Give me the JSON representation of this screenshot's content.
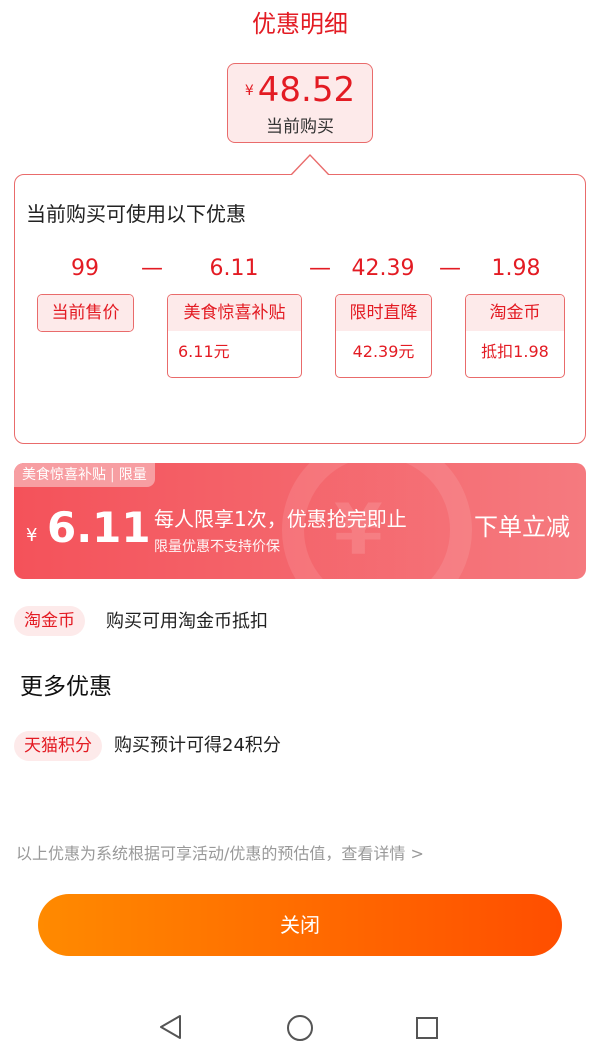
{
  "header": {
    "title": "优惠明细"
  },
  "current_price": {
    "currency": "¥",
    "amount": "48.52",
    "label": "当前购买"
  },
  "breakdown": {
    "title": "当前购买可使用以下优惠",
    "formula": {
      "base": "99",
      "minus": "—",
      "item1": "6.11",
      "item2": "42.39",
      "item3": "1.98"
    },
    "chips": [
      {
        "label": "当前售价",
        "value": ""
      },
      {
        "label": "美食惊喜补贴",
        "value": "6.11元"
      },
      {
        "label": "限时直降",
        "value": "42.39元"
      },
      {
        "label": "淘金币",
        "value": "抵扣1.98"
      }
    ]
  },
  "coupon": {
    "tag": "美食惊喜补贴",
    "tag_limit": "限量",
    "tag_separator": "|",
    "currency": "¥",
    "amount": "6.11",
    "main_text": "每人限享1次，优惠抢完即止",
    "sub_text": "限量优惠不支持价保",
    "action": "下单立减"
  },
  "taojinbi": {
    "tag": "淘金币",
    "text": "购买可用淘金币抵扣"
  },
  "more": {
    "title": "更多优惠",
    "tmall_points": {
      "tag": "天猫积分",
      "text": "购买预计可得24积分"
    }
  },
  "footer_note": "以上优惠为系统根据可享活动/优惠的预估值，查看详情 >",
  "close_button": "关闭",
  "nav": {
    "back": "back-icon",
    "home": "home-icon",
    "recents": "recents-icon"
  },
  "colors": {
    "accent": "#e31b23",
    "coupon": "#f4525a",
    "button": "#ff6a00"
  }
}
